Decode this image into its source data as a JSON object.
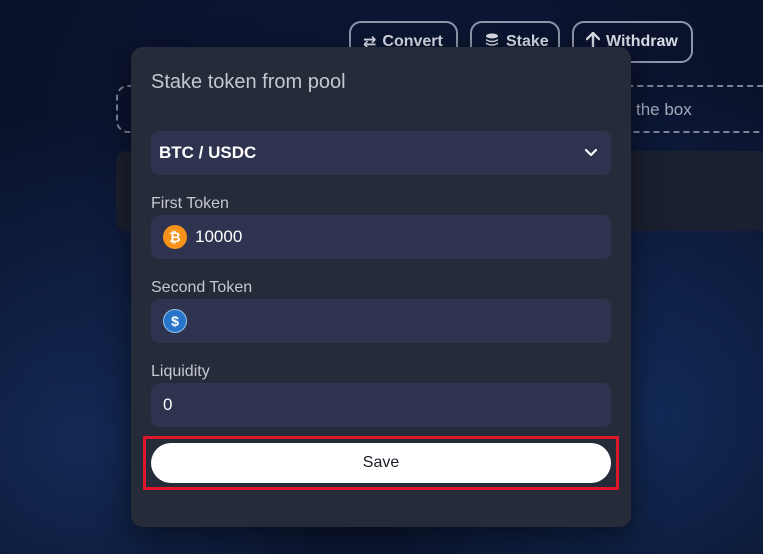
{
  "toolbar": {
    "convert_label": "Convert",
    "stake_label": "Stake",
    "withdraw_label": "Withdraw"
  },
  "dropzone": {
    "text": "the box"
  },
  "modal": {
    "title": "Stake token from pool",
    "pair_select": {
      "value": "BTC / USDC"
    },
    "first_token": {
      "label": "First Token",
      "value": "10000",
      "icon": "bitcoin-icon"
    },
    "second_token": {
      "label": "Second Token",
      "value": "",
      "icon": "usdc-icon"
    },
    "liquidity": {
      "label": "Liquidity",
      "value": "0"
    },
    "save_label": "Save"
  },
  "colors": {
    "modal_bg": "#262b3a",
    "input_bg": "#2e3450",
    "highlight": "#e0162b",
    "btc": "#f7931a",
    "usdc": "#2775ca"
  }
}
